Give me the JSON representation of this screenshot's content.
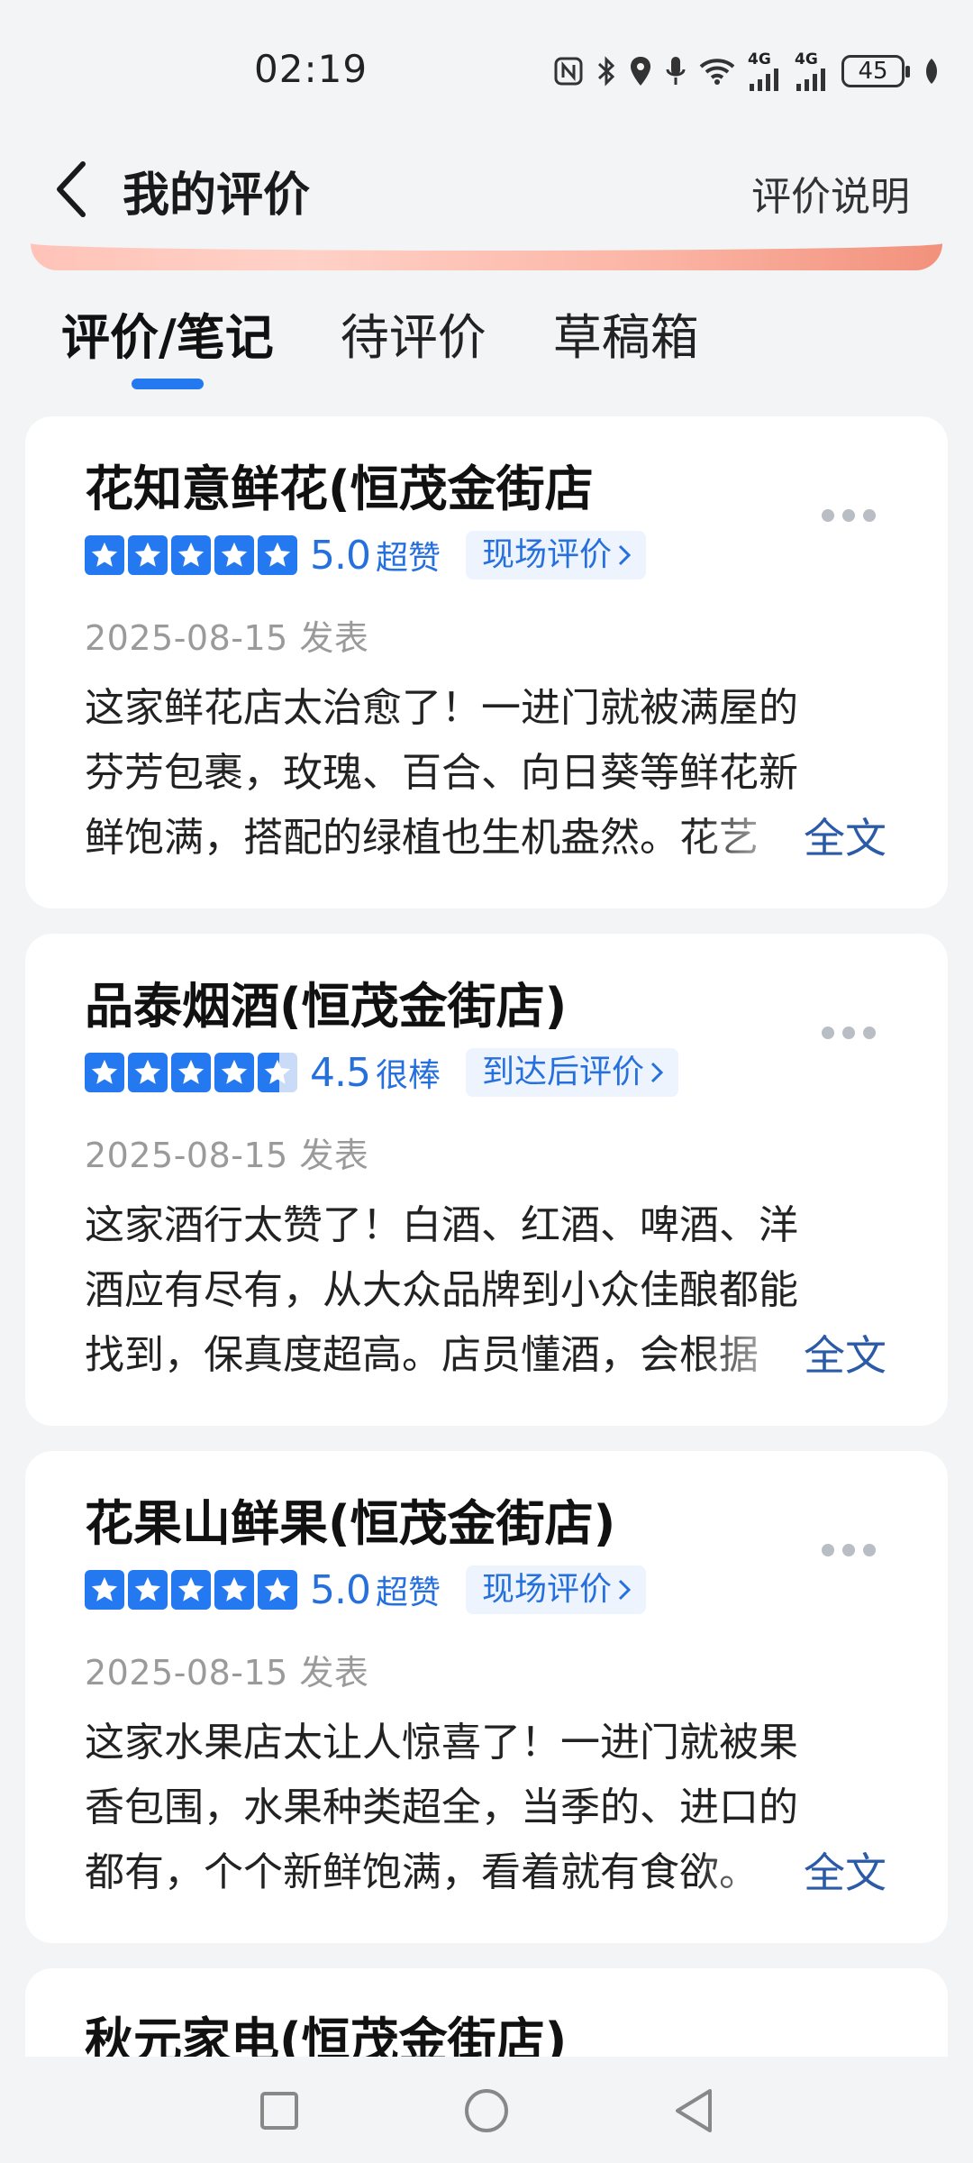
{
  "status_bar": {
    "time": "02:19",
    "network1": "4G",
    "network2": "4G",
    "battery": "45",
    "icons": [
      "nfc-icon",
      "bluetooth-icon",
      "location-icon",
      "mic-icon",
      "wifi-icon",
      "signal-icon",
      "signal-icon",
      "battery-icon",
      "leaf-icon"
    ]
  },
  "header": {
    "title": "我的评价",
    "right_link": "评价说明"
  },
  "tabs": [
    {
      "label": "评价/笔记",
      "active": true
    },
    {
      "label": "待评价",
      "active": false
    },
    {
      "label": "草稿箱",
      "active": false
    }
  ],
  "reviews": [
    {
      "shop": "花知意鲜花(恒茂金街店",
      "stars": 5,
      "score": "5.0",
      "score_word": "超赞",
      "tag": "现场评价",
      "date": "2025-08-15 发表",
      "lines": [
        "这家鲜花店太治愈了！一进门就被满屋的",
        "芬芳包裹，玫瑰、百合、向日葵等鲜花新",
        "鲜饱满，搭配的绿植也生机盎然。花艺"
      ],
      "full_text": "全文"
    },
    {
      "shop": "品泰烟酒(恒茂金街店)",
      "stars": 4.5,
      "score": "4.5",
      "score_word": "很棒",
      "tag": "到达后评价",
      "date": "2025-08-15 发表",
      "lines": [
        "这家酒行太赞了！白酒、红酒、啤酒、洋",
        "酒应有尽有，从大众品牌到小众佳酿都能",
        "找到，保真度超高。店员懂酒，会根据"
      ],
      "full_text": "全文"
    },
    {
      "shop": "花果山鲜果(恒茂金街店)",
      "stars": 5,
      "score": "5.0",
      "score_word": "超赞",
      "tag": "现场评价",
      "date": "2025-08-15 发表",
      "lines": [
        "这家水果店太让人惊喜了！一进门就被果",
        "香包围，水果种类超全，当季的、进口的",
        "都有，个个新鲜饱满，看着就有食欲。"
      ],
      "full_text": "全文"
    },
    {
      "shop": "秋元家电(恒茂金街店)"
    }
  ],
  "colors": {
    "accent": "#2478f0",
    "score": "#2670dd",
    "link": "#2a5aa8",
    "background": "#f3f4f6"
  }
}
